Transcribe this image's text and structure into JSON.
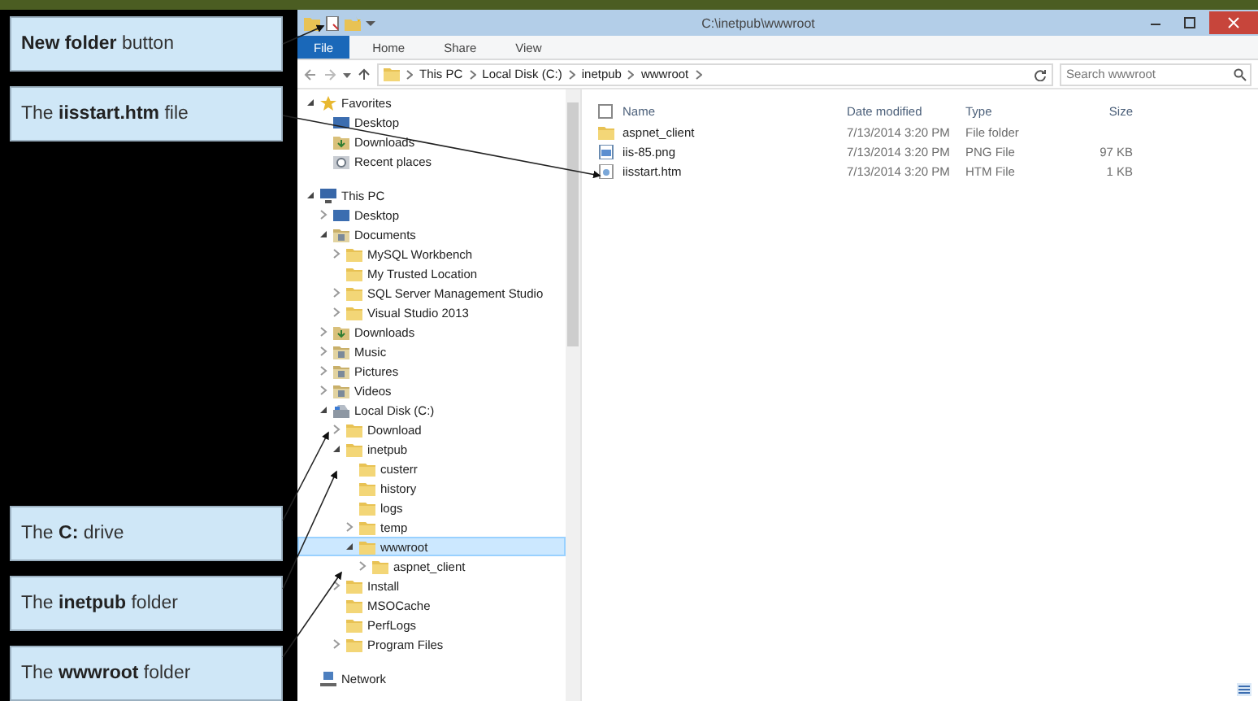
{
  "callouts": [
    {
      "text": "**New folder** button"
    },
    {
      "text": "The **iisstart.htm** file"
    },
    {
      "text": "The **C:** drive"
    },
    {
      "text": "The **inetpub** folder"
    },
    {
      "text": "The **wwwroot** folder"
    }
  ],
  "window": {
    "title": "C:\\inetpub\\wwwroot"
  },
  "tabs": [
    {
      "label": "File",
      "selected": true
    },
    {
      "label": "Home",
      "selected": false
    },
    {
      "label": "Share",
      "selected": false
    },
    {
      "label": "View",
      "selected": false
    }
  ],
  "address": {
    "crumbs": [
      "This PC",
      "Local Disk (C:)",
      "inetpub",
      "wwwroot"
    ]
  },
  "search": {
    "placeholder": "Search wwwroot"
  },
  "tree": [
    {
      "label": "Favorites",
      "kind": "star",
      "expanded": true,
      "selected": false,
      "children": [
        {
          "label": "Desktop",
          "kind": "desktop",
          "selected": false
        },
        {
          "label": "Downloads",
          "kind": "downloads",
          "selected": false
        },
        {
          "label": "Recent places",
          "kind": "recent",
          "selected": false
        }
      ]
    },
    {
      "label": "This PC",
      "kind": "pc",
      "expanded": true,
      "selected": false,
      "children": [
        {
          "label": "Desktop",
          "kind": "desktop",
          "expanded": false,
          "selected": false
        },
        {
          "label": "Documents",
          "kind": "library",
          "expanded": true,
          "selected": false,
          "children": [
            {
              "label": "MySQL Workbench",
              "kind": "folder",
              "expanded": false,
              "selected": false
            },
            {
              "label": "My Trusted Location",
              "kind": "folder",
              "selected": false
            },
            {
              "label": "SQL Server Management Studio",
              "kind": "folder",
              "expanded": false,
              "selected": false
            },
            {
              "label": "Visual Studio 2013",
              "kind": "folder",
              "expanded": false,
              "selected": false
            }
          ]
        },
        {
          "label": "Downloads",
          "kind": "downloads",
          "expanded": false,
          "selected": false
        },
        {
          "label": "Music",
          "kind": "library",
          "expanded": false,
          "selected": false
        },
        {
          "label": "Pictures",
          "kind": "library",
          "expanded": false,
          "selected": false
        },
        {
          "label": "Videos",
          "kind": "library",
          "expanded": false,
          "selected": false
        },
        {
          "label": "Local Disk (C:)",
          "kind": "drive",
          "expanded": true,
          "selected": false,
          "children": [
            {
              "label": "Download",
              "kind": "folder",
              "expanded": false,
              "selected": false
            },
            {
              "label": "inetpub",
              "kind": "folder",
              "expanded": true,
              "selected": false,
              "children": [
                {
                  "label": "custerr",
                  "kind": "folder",
                  "selected": false
                },
                {
                  "label": "history",
                  "kind": "folder",
                  "selected": false
                },
                {
                  "label": "logs",
                  "kind": "folder",
                  "selected": false
                },
                {
                  "label": "temp",
                  "kind": "folder",
                  "expanded": false,
                  "selected": false
                },
                {
                  "label": "wwwroot",
                  "kind": "folder",
                  "expanded": true,
                  "selected": true,
                  "children": [
                    {
                      "label": "aspnet_client",
                      "kind": "folder",
                      "expanded": false,
                      "selected": false
                    }
                  ]
                }
              ]
            },
            {
              "label": "Install",
              "kind": "folder",
              "expanded": false,
              "selected": false
            },
            {
              "label": "MSOCache",
              "kind": "folder",
              "selected": false
            },
            {
              "label": "PerfLogs",
              "kind": "folder",
              "selected": false
            },
            {
              "label": "Program Files",
              "kind": "folder",
              "expanded": false,
              "selected": false
            }
          ]
        }
      ]
    },
    {
      "label": "Network",
      "kind": "network",
      "selected": false
    }
  ],
  "columns": [
    "Name",
    "Date modified",
    "Type",
    "Size"
  ],
  "select_all": {
    "checked": false
  },
  "files": [
    {
      "name": "aspnet_client",
      "kind": "folder",
      "date": "7/13/2014 3:20 PM",
      "type": "File folder"
    },
    {
      "name": "iis-85.png",
      "kind": "image",
      "date": "7/13/2014 3:20 PM",
      "type": "PNG File",
      "size": "97 KB"
    },
    {
      "name": "iisstart.htm",
      "kind": "html",
      "date": "7/13/2014 3:20 PM",
      "type": "HTM File",
      "size": "1 KB"
    }
  ]
}
